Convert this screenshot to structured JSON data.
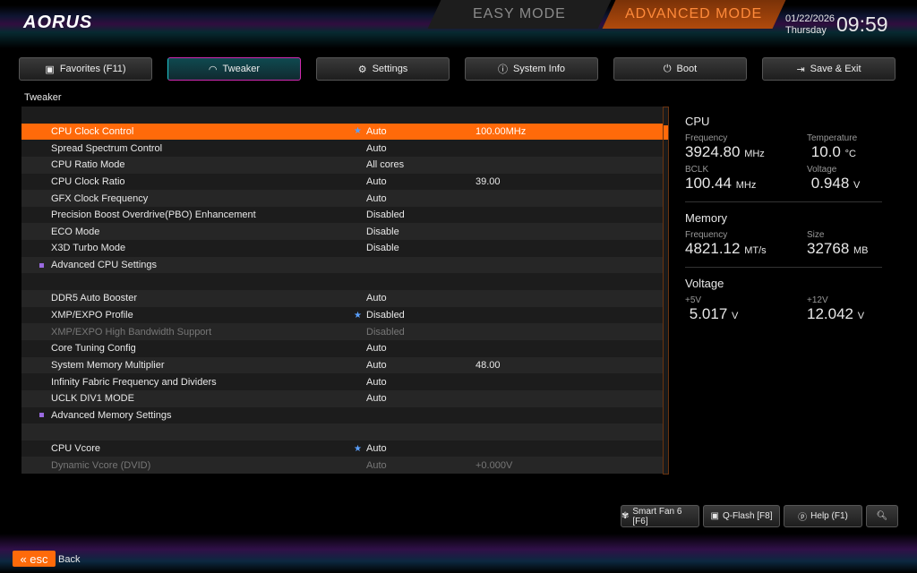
{
  "header": {
    "logo": "AORUS",
    "easy_mode": "EASY MODE",
    "advanced_mode": "ADVANCED MODE",
    "date": "01/22/2026",
    "day": "Thursday",
    "time": "09:59"
  },
  "tabs": [
    {
      "label": "Favorites (F11)",
      "icon": "favorites-icon"
    },
    {
      "label": "Tweaker",
      "icon": "gauge-icon"
    },
    {
      "label": "Settings",
      "icon": "gear-icon"
    },
    {
      "label": "System Info",
      "icon": "info-icon"
    },
    {
      "label": "Boot",
      "icon": "power-icon"
    },
    {
      "label": "Save & Exit",
      "icon": "exit-icon"
    }
  ],
  "breadcrumb": "Tweaker",
  "settings": [
    {
      "name": "",
      "value": "",
      "extra": ""
    },
    {
      "name": "CPU Clock Control",
      "value": "Auto",
      "extra": "100.00MHz",
      "star": true,
      "selected": true
    },
    {
      "name": "Spread Spectrum Control",
      "value": "Auto",
      "extra": ""
    },
    {
      "name": "CPU Ratio Mode",
      "value": "All cores",
      "extra": ""
    },
    {
      "name": "CPU Clock Ratio",
      "value": "Auto",
      "extra": "39.00"
    },
    {
      "name": "GFX Clock Frequency",
      "value": "Auto",
      "extra": ""
    },
    {
      "name": "Precision Boost Overdrive(PBO) Enhancement",
      "value": "Disabled",
      "extra": ""
    },
    {
      "name": "ECO Mode",
      "value": "Disable",
      "extra": ""
    },
    {
      "name": "X3D Turbo Mode",
      "value": "Disable",
      "extra": ""
    },
    {
      "name": "Advanced CPU Settings",
      "value": "",
      "extra": "",
      "submenu": true
    },
    {
      "name": "",
      "value": "",
      "extra": ""
    },
    {
      "name": "DDR5 Auto Booster",
      "value": "Auto",
      "extra": ""
    },
    {
      "name": "XMP/EXPO Profile",
      "value": "Disabled",
      "extra": "",
      "star": true
    },
    {
      "name": "XMP/EXPO High Bandwidth Support",
      "value": "Disabled",
      "extra": "",
      "dim": true
    },
    {
      "name": "Core Tuning Config",
      "value": "Auto",
      "extra": ""
    },
    {
      "name": "System Memory Multiplier",
      "value": "Auto",
      "extra": "48.00"
    },
    {
      "name": "Infinity Fabric Frequency and Dividers",
      "value": "Auto",
      "extra": ""
    },
    {
      "name": "UCLK DIV1 MODE",
      "value": "Auto",
      "extra": ""
    },
    {
      "name": "Advanced Memory Settings",
      "value": "",
      "extra": "",
      "submenu": true
    },
    {
      "name": "",
      "value": "",
      "extra": ""
    },
    {
      "name": "CPU Vcore",
      "value": "Auto",
      "extra": "",
      "star": true
    },
    {
      "name": "Dynamic Vcore (DVID)",
      "value": "Auto",
      "extra": "+0.000V",
      "dim": true
    }
  ],
  "star_glyph": "★",
  "info": {
    "cpu": {
      "title": "CPU",
      "freq_label": "Frequency",
      "freq": "3924.80",
      "freq_unit": "MHz",
      "temp_label": "Temperature",
      "temp": "10.0",
      "temp_unit": "°C",
      "bclk_label": "BCLK",
      "bclk": "100.44",
      "bclk_unit": "MHz",
      "volt_label": "Voltage",
      "volt": "0.948",
      "volt_unit": "V"
    },
    "memory": {
      "title": "Memory",
      "freq_label": "Frequency",
      "freq": "4821.12",
      "freq_unit": "MT/s",
      "size_label": "Size",
      "size": "32768",
      "size_unit": "MB"
    },
    "voltage": {
      "title": "Voltage",
      "v5_label": "+5V",
      "v5": "5.017",
      "v5_unit": "V",
      "v12_label": "+12V",
      "v12": "12.042",
      "v12_unit": "V"
    }
  },
  "bottom": {
    "smartfan": "Smart Fan 6 [F6]",
    "qflash": "Q-Flash [F8]",
    "help": "Help (F1)",
    "esc": "esc",
    "back": "Back"
  }
}
